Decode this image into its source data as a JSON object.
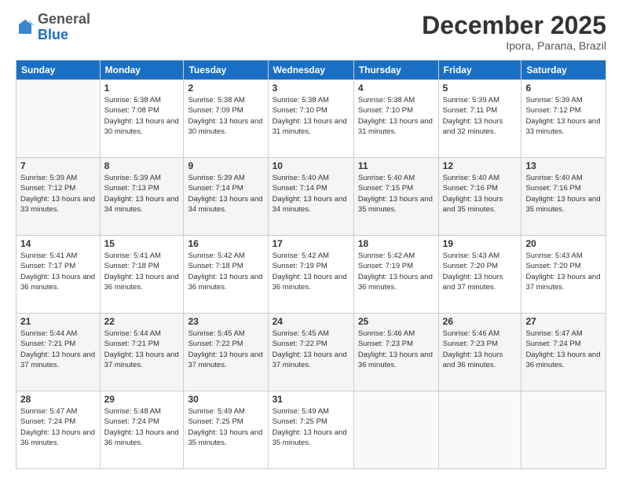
{
  "header": {
    "logo_general": "General",
    "logo_blue": "Blue",
    "month_title": "December 2025",
    "subtitle": "Ipora, Parana, Brazil"
  },
  "weekdays": [
    "Sunday",
    "Monday",
    "Tuesday",
    "Wednesday",
    "Thursday",
    "Friday",
    "Saturday"
  ],
  "weeks": [
    [
      {
        "day": "",
        "sunrise": "",
        "sunset": "",
        "daylight": ""
      },
      {
        "day": "1",
        "sunrise": "Sunrise: 5:38 AM",
        "sunset": "Sunset: 7:08 PM",
        "daylight": "Daylight: 13 hours and 30 minutes."
      },
      {
        "day": "2",
        "sunrise": "Sunrise: 5:38 AM",
        "sunset": "Sunset: 7:09 PM",
        "daylight": "Daylight: 13 hours and 30 minutes."
      },
      {
        "day": "3",
        "sunrise": "Sunrise: 5:38 AM",
        "sunset": "Sunset: 7:10 PM",
        "daylight": "Daylight: 13 hours and 31 minutes."
      },
      {
        "day": "4",
        "sunrise": "Sunrise: 5:38 AM",
        "sunset": "Sunset: 7:10 PM",
        "daylight": "Daylight: 13 hours and 31 minutes."
      },
      {
        "day": "5",
        "sunrise": "Sunrise: 5:39 AM",
        "sunset": "Sunset: 7:11 PM",
        "daylight": "Daylight: 13 hours and 32 minutes."
      },
      {
        "day": "6",
        "sunrise": "Sunrise: 5:39 AM",
        "sunset": "Sunset: 7:12 PM",
        "daylight": "Daylight: 13 hours and 33 minutes."
      }
    ],
    [
      {
        "day": "7",
        "sunrise": "Sunrise: 5:39 AM",
        "sunset": "Sunset: 7:12 PM",
        "daylight": "Daylight: 13 hours and 33 minutes."
      },
      {
        "day": "8",
        "sunrise": "Sunrise: 5:39 AM",
        "sunset": "Sunset: 7:13 PM",
        "daylight": "Daylight: 13 hours and 34 minutes."
      },
      {
        "day": "9",
        "sunrise": "Sunrise: 5:39 AM",
        "sunset": "Sunset: 7:14 PM",
        "daylight": "Daylight: 13 hours and 34 minutes."
      },
      {
        "day": "10",
        "sunrise": "Sunrise: 5:40 AM",
        "sunset": "Sunset: 7:14 PM",
        "daylight": "Daylight: 13 hours and 34 minutes."
      },
      {
        "day": "11",
        "sunrise": "Sunrise: 5:40 AM",
        "sunset": "Sunset: 7:15 PM",
        "daylight": "Daylight: 13 hours and 35 minutes."
      },
      {
        "day": "12",
        "sunrise": "Sunrise: 5:40 AM",
        "sunset": "Sunset: 7:16 PM",
        "daylight": "Daylight: 13 hours and 35 minutes."
      },
      {
        "day": "13",
        "sunrise": "Sunrise: 5:40 AM",
        "sunset": "Sunset: 7:16 PM",
        "daylight": "Daylight: 13 hours and 35 minutes."
      }
    ],
    [
      {
        "day": "14",
        "sunrise": "Sunrise: 5:41 AM",
        "sunset": "Sunset: 7:17 PM",
        "daylight": "Daylight: 13 hours and 36 minutes."
      },
      {
        "day": "15",
        "sunrise": "Sunrise: 5:41 AM",
        "sunset": "Sunset: 7:18 PM",
        "daylight": "Daylight: 13 hours and 36 minutes."
      },
      {
        "day": "16",
        "sunrise": "Sunrise: 5:42 AM",
        "sunset": "Sunset: 7:18 PM",
        "daylight": "Daylight: 13 hours and 36 minutes."
      },
      {
        "day": "17",
        "sunrise": "Sunrise: 5:42 AM",
        "sunset": "Sunset: 7:19 PM",
        "daylight": "Daylight: 13 hours and 36 minutes."
      },
      {
        "day": "18",
        "sunrise": "Sunrise: 5:42 AM",
        "sunset": "Sunset: 7:19 PM",
        "daylight": "Daylight: 13 hours and 36 minutes."
      },
      {
        "day": "19",
        "sunrise": "Sunrise: 5:43 AM",
        "sunset": "Sunset: 7:20 PM",
        "daylight": "Daylight: 13 hours and 37 minutes."
      },
      {
        "day": "20",
        "sunrise": "Sunrise: 5:43 AM",
        "sunset": "Sunset: 7:20 PM",
        "daylight": "Daylight: 13 hours and 37 minutes."
      }
    ],
    [
      {
        "day": "21",
        "sunrise": "Sunrise: 5:44 AM",
        "sunset": "Sunset: 7:21 PM",
        "daylight": "Daylight: 13 hours and 37 minutes."
      },
      {
        "day": "22",
        "sunrise": "Sunrise: 5:44 AM",
        "sunset": "Sunset: 7:21 PM",
        "daylight": "Daylight: 13 hours and 37 minutes."
      },
      {
        "day": "23",
        "sunrise": "Sunrise: 5:45 AM",
        "sunset": "Sunset: 7:22 PM",
        "daylight": "Daylight: 13 hours and 37 minutes."
      },
      {
        "day": "24",
        "sunrise": "Sunrise: 5:45 AM",
        "sunset": "Sunset: 7:22 PM",
        "daylight": "Daylight: 13 hours and 37 minutes."
      },
      {
        "day": "25",
        "sunrise": "Sunrise: 5:46 AM",
        "sunset": "Sunset: 7:23 PM",
        "daylight": "Daylight: 13 hours and 36 minutes."
      },
      {
        "day": "26",
        "sunrise": "Sunrise: 5:46 AM",
        "sunset": "Sunset: 7:23 PM",
        "daylight": "Daylight: 13 hours and 36 minutes."
      },
      {
        "day": "27",
        "sunrise": "Sunrise: 5:47 AM",
        "sunset": "Sunset: 7:24 PM",
        "daylight": "Daylight: 13 hours and 36 minutes."
      }
    ],
    [
      {
        "day": "28",
        "sunrise": "Sunrise: 5:47 AM",
        "sunset": "Sunset: 7:24 PM",
        "daylight": "Daylight: 13 hours and 36 minutes."
      },
      {
        "day": "29",
        "sunrise": "Sunrise: 5:48 AM",
        "sunset": "Sunset: 7:24 PM",
        "daylight": "Daylight: 13 hours and 36 minutes."
      },
      {
        "day": "30",
        "sunrise": "Sunrise: 5:49 AM",
        "sunset": "Sunset: 7:25 PM",
        "daylight": "Daylight: 13 hours and 35 minutes."
      },
      {
        "day": "31",
        "sunrise": "Sunrise: 5:49 AM",
        "sunset": "Sunset: 7:25 PM",
        "daylight": "Daylight: 13 hours and 35 minutes."
      },
      {
        "day": "",
        "sunrise": "",
        "sunset": "",
        "daylight": ""
      },
      {
        "day": "",
        "sunrise": "",
        "sunset": "",
        "daylight": ""
      },
      {
        "day": "",
        "sunrise": "",
        "sunset": "",
        "daylight": ""
      }
    ]
  ]
}
